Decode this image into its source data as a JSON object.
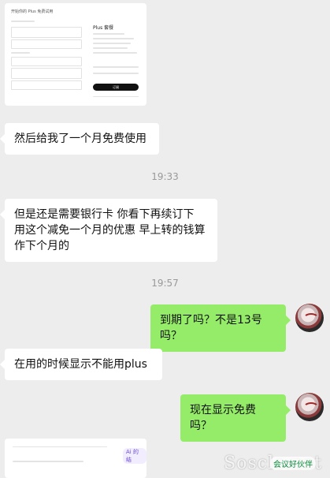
{
  "messages": {
    "m1": "然后给我了一个月免费使用",
    "m2": "但是还是需要银行卡 你看下再续订下 用这个减免一个月的优惠 早上转的钱算作下个月的",
    "m3": "到期了吗？不是13号吗？",
    "m4": "在用的时候显示不能用plus",
    "m5": "现在显示免费吗？"
  },
  "times": {
    "t1": "19:33",
    "t2": "19:57"
  },
  "screenshot1": {
    "header": "开始你的 Plus 免费试用",
    "plan_title": "Plus 套餐",
    "pay_button": "订阅"
  },
  "screenshot2": {
    "tag": "Ai 的结"
  },
  "watermark": "Sosclo.net",
  "watermark_sub": "会议好伙伴"
}
